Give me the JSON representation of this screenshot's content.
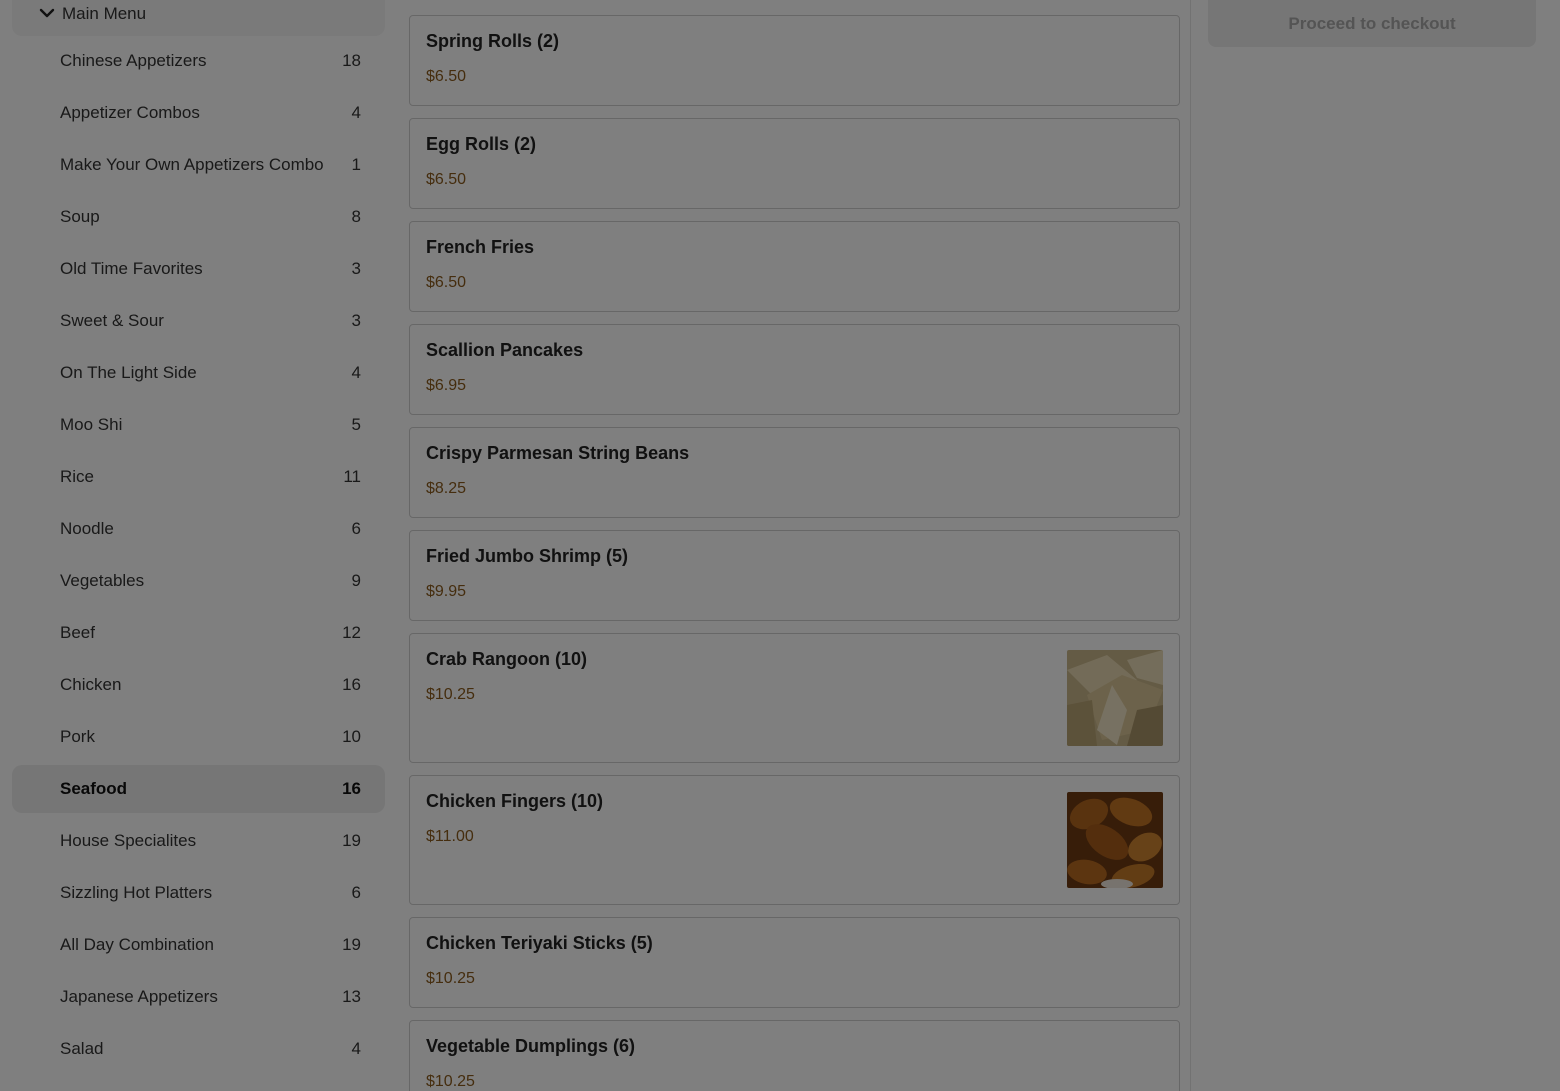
{
  "sidebar": {
    "header_label": "Main Menu",
    "categories": [
      {
        "label": "Chinese Appetizers",
        "count": "18"
      },
      {
        "label": "Appetizer Combos",
        "count": "4"
      },
      {
        "label": "Make Your Own Appetizers Combo",
        "count": "1"
      },
      {
        "label": "Soup",
        "count": "8"
      },
      {
        "label": "Old Time Favorites",
        "count": "3"
      },
      {
        "label": "Sweet & Sour",
        "count": "3"
      },
      {
        "label": "On The Light Side",
        "count": "4"
      },
      {
        "label": "Moo Shi",
        "count": "5"
      },
      {
        "label": "Rice",
        "count": "11"
      },
      {
        "label": "Noodle",
        "count": "6"
      },
      {
        "label": "Vegetables",
        "count": "9"
      },
      {
        "label": "Beef",
        "count": "12"
      },
      {
        "label": "Chicken",
        "count": "16"
      },
      {
        "label": "Pork",
        "count": "10"
      },
      {
        "label": "Seafood",
        "count": "16"
      },
      {
        "label": "House Specialites",
        "count": "19"
      },
      {
        "label": "Sizzling Hot Platters",
        "count": "6"
      },
      {
        "label": "All Day Combination",
        "count": "19"
      },
      {
        "label": "Japanese Appetizers",
        "count": "13"
      },
      {
        "label": "Salad",
        "count": "4"
      }
    ]
  },
  "menu_items": [
    {
      "name": "Spring Rolls (2)",
      "price": "$6.50"
    },
    {
      "name": "Egg Rolls (2)",
      "price": "$6.50"
    },
    {
      "name": "French Fries",
      "price": "$6.50"
    },
    {
      "name": "Scallion Pancakes",
      "price": "$6.95"
    },
    {
      "name": "Crispy Parmesan String Beans",
      "price": "$8.25"
    },
    {
      "name": "Fried Jumbo Shrimp (5)",
      "price": "$9.95"
    },
    {
      "name": "Crab Rangoon (10)",
      "price": "$10.25"
    },
    {
      "name": "Chicken Fingers (10)",
      "price": "$11.00"
    },
    {
      "name": "Chicken Teriyaki Sticks (5)",
      "price": "$10.25"
    },
    {
      "name": "Vegetable Dumplings (6)",
      "price": "$10.25"
    }
  ],
  "cart": {
    "checkout_label": "Proceed to checkout"
  },
  "colors": {
    "price": "#8a5a1c",
    "overlay": "rgba(0,0,0,0.5)",
    "active_category_bg": "#ececec"
  }
}
